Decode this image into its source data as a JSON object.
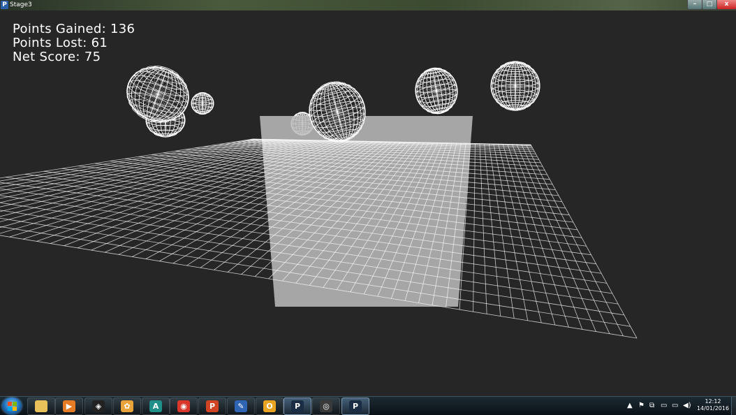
{
  "window": {
    "title": "Stage3",
    "app_icon_glyph": "P",
    "minimize_glyph": "–",
    "maximize_glyph": "□",
    "close_glyph": "x"
  },
  "hud": {
    "points_gained": "Points Gained: 136",
    "points_lost": "Points Lost: 61",
    "net_score": "Net Score: 75"
  },
  "scene": {
    "line_color": "#ffffff",
    "background_color": "#262626",
    "basket_color": "#bdbdbd"
  },
  "taskbar": {
    "apps": [
      {
        "icon": "file-explorer-icon",
        "color": "#e9c15a",
        "glyph": ""
      },
      {
        "icon": "media-player-icon",
        "color": "#e57b24",
        "glyph": "▶"
      },
      {
        "icon": "unity-icon",
        "color": "#222222",
        "glyph": "◈"
      },
      {
        "icon": "paint-icon",
        "color": "#e8a33a",
        "glyph": "✿"
      },
      {
        "icon": "autodesk-icon",
        "color": "#1f8f8a",
        "glyph": "A"
      },
      {
        "icon": "chrome-icon",
        "color": "#d9372b",
        "glyph": "◉"
      },
      {
        "icon": "powerpoint-icon",
        "color": "#d04423",
        "glyph": "P"
      },
      {
        "icon": "pen-tool-icon",
        "color": "#2f64b5",
        "glyph": "✎"
      },
      {
        "icon": "outlook-icon",
        "color": "#e9a421",
        "glyph": "O"
      },
      {
        "icon": "processing-icon",
        "color": "#1b2d44",
        "glyph": "P"
      },
      {
        "icon": "game-controller-icon",
        "color": "#3a3a3a",
        "glyph": "◎"
      },
      {
        "icon": "processing-running-icon",
        "color": "#1b2d44",
        "glyph": "P"
      }
    ],
    "tray": {
      "show_hidden": "▲",
      "flag": "⚑",
      "network": "⧉",
      "power": "▭",
      "speaker": "◀)"
    },
    "clock": {
      "time": "12:12",
      "date": "14/01/2016"
    }
  }
}
